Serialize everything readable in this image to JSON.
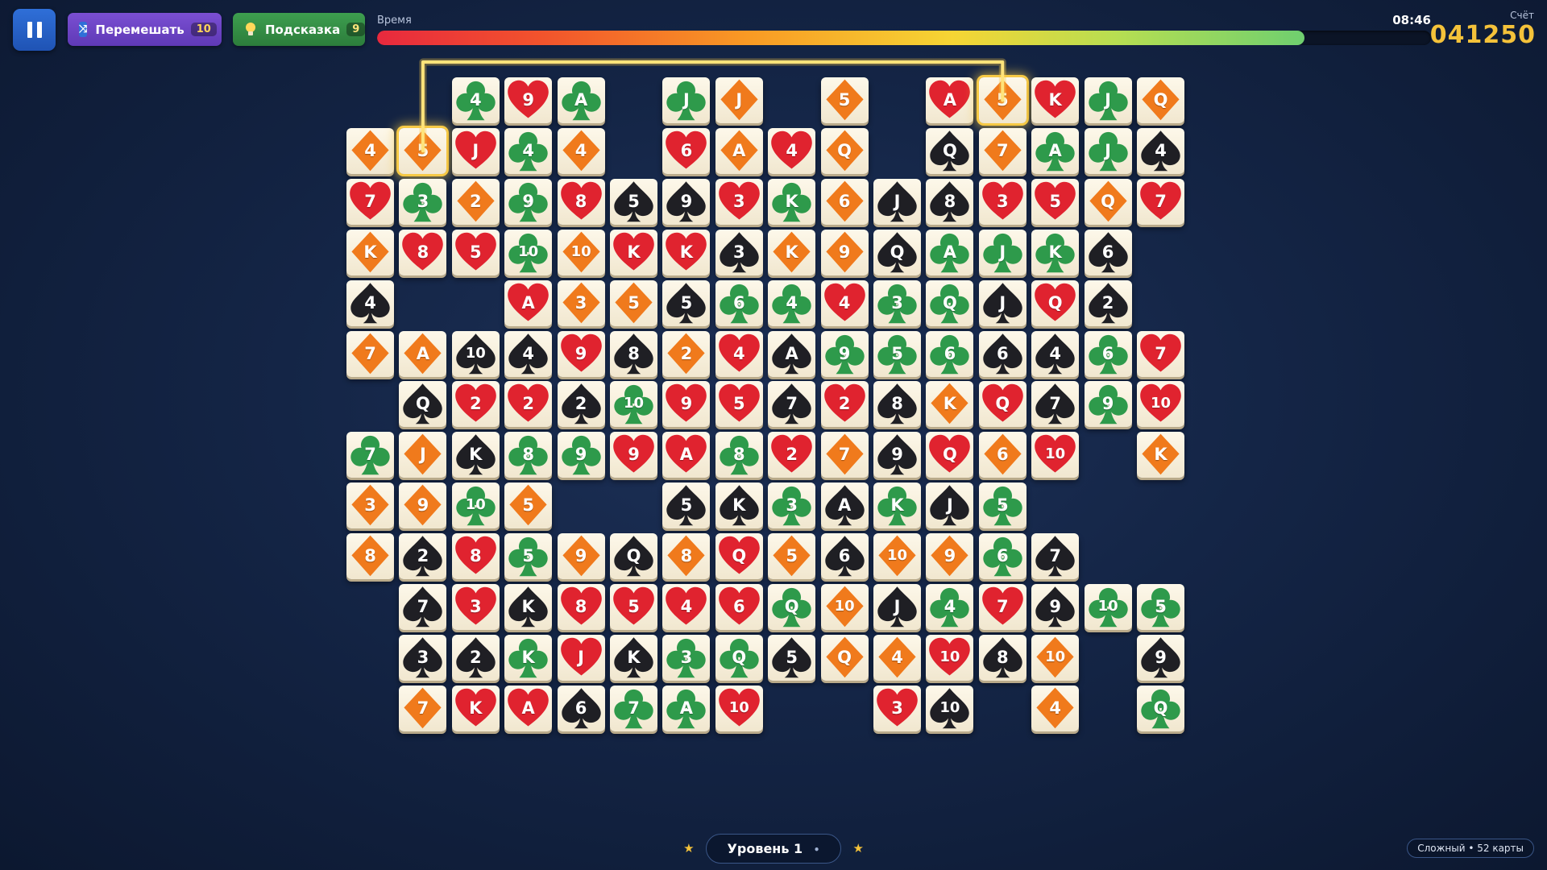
{
  "header": {
    "shuffle_label": "Перемешать",
    "shuffle_count": "10",
    "hint_label": "Подсказка",
    "hint_count": "9",
    "time_label": "Время",
    "time_value": "08:46",
    "time_remaining_fraction": 0.88,
    "score_label": "Счёт",
    "score_value": "041250"
  },
  "footer": {
    "level_label": "Уровень 1",
    "level_dot": "•",
    "star": "★",
    "difficulty": "Сложный • 52 карты"
  },
  "colors": {
    "H": "#e0232f",
    "D": "#f07a1c",
    "C": "#2e9a4b",
    "S": "#1f1f24",
    "selection": "#f6c945"
  },
  "board": {
    "cols": 16,
    "rows": 13,
    "rows_data": [
      [
        null,
        null,
        "4C",
        "9H",
        "AC",
        null,
        "JC",
        "JD",
        null,
        "5D",
        null,
        "AH",
        "5D",
        "KH",
        "JC",
        "QD"
      ],
      [
        "4D",
        "5D",
        "JH",
        "4C",
        "4D",
        null,
        "6H",
        "AD",
        "4H",
        "QD",
        null,
        "QS",
        "7D",
        "AC",
        "JC",
        "4S"
      ],
      [
        "7H",
        "3C",
        "2D",
        "9C",
        "8H",
        "5S",
        "9S",
        "3H",
        "KC",
        "6D",
        "JS",
        "8S",
        "3H",
        "5H",
        "QD",
        "7H"
      ],
      [
        "KD",
        "8H",
        "5H",
        "10C",
        "10D",
        "KH",
        "KH",
        "3S",
        "KD",
        "9D",
        "QS",
        "AC",
        "JC",
        "KC",
        "6S",
        null
      ],
      [
        "4S",
        null,
        null,
        "AH",
        "3D",
        "5D",
        "5S",
        "6C",
        "4C",
        "4H",
        "3C",
        "QC",
        "JS",
        "QH",
        "2S",
        null
      ],
      [
        "7D",
        "AD",
        "10S",
        "4S",
        "9H",
        "8S",
        "2D",
        "4H",
        "AS",
        "9C",
        "5C",
        "6C",
        "6S",
        "4S",
        "6C",
        "7H"
      ],
      [
        null,
        "QS",
        "2H",
        "2H",
        "2S",
        "10C",
        "9H",
        "5H",
        "7S",
        "2H",
        "8S",
        "KD",
        "QH",
        "7S",
        "9C",
        "10H"
      ],
      [
        "7C",
        "JD",
        "KS",
        "8C",
        "9C",
        "9H",
        "AH",
        "8C",
        "2H",
        "7D",
        "9S",
        "QH",
        "6D",
        "10H",
        null,
        "KD"
      ],
      [
        "3D",
        "9D",
        "10C",
        "5D",
        null,
        null,
        "5S",
        "KS",
        "3C",
        "AS",
        "KC",
        "JS",
        "5C",
        null,
        null,
        null
      ],
      [
        "8D",
        "2S",
        "8H",
        "5C",
        "9D",
        "QS",
        "8D",
        "QH",
        "5D",
        "6S",
        "10D",
        "9D",
        "6C",
        "7S",
        null,
        null
      ],
      [
        null,
        "7S",
        "3H",
        "KS",
        "8H",
        "5H",
        "4H",
        "6H",
        "QC",
        "10D",
        "JS",
        "4C",
        "7H",
        "9S",
        "10C",
        "5C"
      ],
      [
        null,
        "3S",
        "2S",
        "KC",
        "JH",
        "KS",
        "3C",
        "QC",
        "5S",
        "QD",
        "4D",
        "10H",
        "8S",
        "10D",
        null,
        "9S"
      ],
      [
        null,
        "7D",
        "KH",
        "AH",
        "6S",
        "7C",
        "AC",
        "10H",
        null,
        null,
        "3H",
        "10S",
        null,
        "4D",
        null,
        "QC"
      ]
    ],
    "selected": [
      [
        0,
        12
      ],
      [
        1,
        1
      ]
    ]
  }
}
